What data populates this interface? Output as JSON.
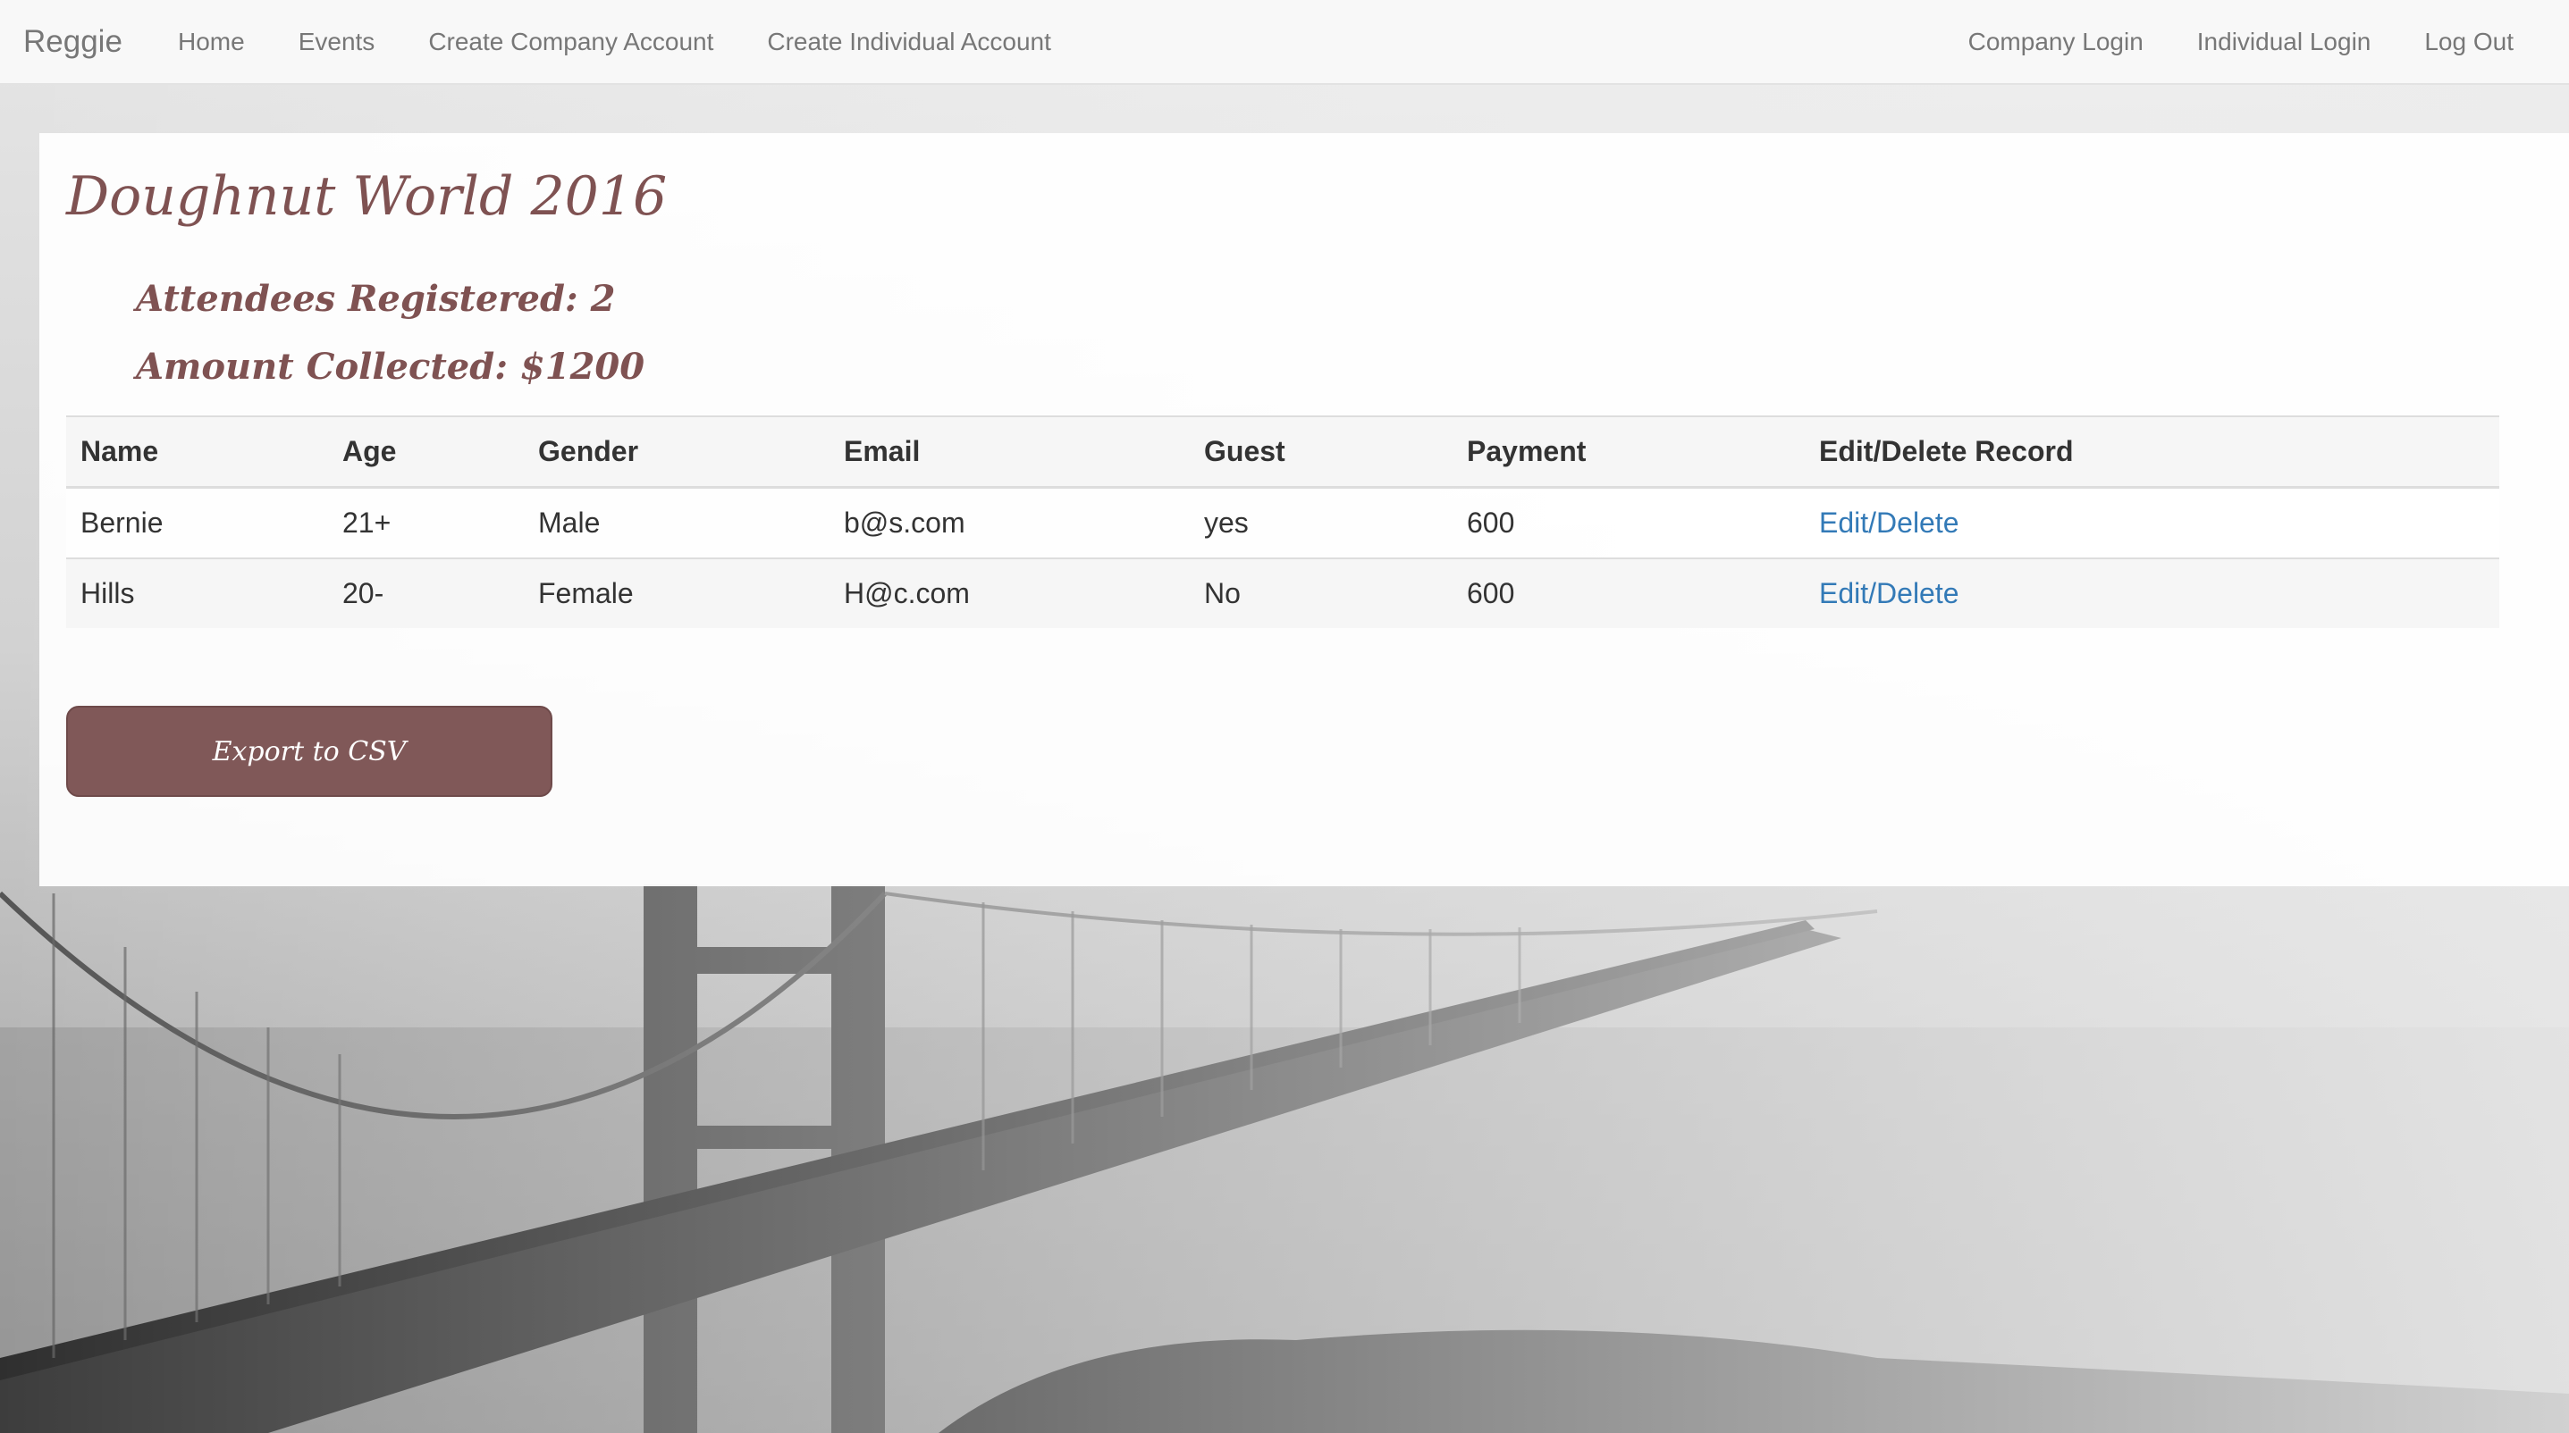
{
  "navbar": {
    "brand": "Reggie",
    "left_links": [
      {
        "label": "Home"
      },
      {
        "label": "Events"
      },
      {
        "label": "Create Company Account"
      },
      {
        "label": "Create Individual Account"
      }
    ],
    "right_links": [
      {
        "label": "Company Login"
      },
      {
        "label": "Individual Login"
      },
      {
        "label": "Log Out"
      }
    ]
  },
  "event": {
    "title": "Doughnut World 2016",
    "attendees_label": "Attendees Registered: 2",
    "amount_label": "Amount Collected: $1200"
  },
  "table": {
    "headers": [
      "Name",
      "Age",
      "Gender",
      "Email",
      "Guest",
      "Payment",
      "Edit/Delete Record"
    ],
    "rows": [
      {
        "name": "Bernie",
        "age": "21+",
        "gender": "Male",
        "email": "b@s.com",
        "guest": "yes",
        "payment": "600",
        "action": "Edit/Delete"
      },
      {
        "name": "Hills",
        "age": "20-",
        "gender": "Female",
        "email": "H@c.com",
        "guest": "No",
        "payment": "600",
        "action": "Edit/Delete"
      }
    ]
  },
  "export_button": {
    "label": "Export to CSV"
  },
  "colors": {
    "accent": "#805858",
    "heading": "#7f5252",
    "link": "#337ab7",
    "nav_text": "#777777"
  }
}
